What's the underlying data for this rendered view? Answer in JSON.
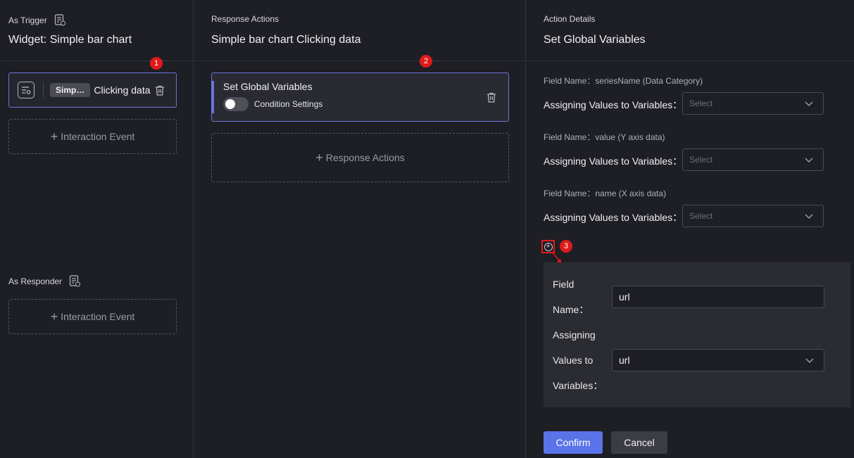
{
  "trigger": {
    "section_label": "As Trigger",
    "title": "Widget: Simple bar chart",
    "card": {
      "chip": "Simp…",
      "event": "Clicking data"
    },
    "add_event": "Interaction Event",
    "badge": "1"
  },
  "responder": {
    "section_label": "As Responder",
    "add_event": "Interaction Event"
  },
  "response": {
    "section_label": "Response Actions",
    "title": "Simple bar chart Clicking data",
    "badge": "2",
    "action": {
      "title": "Set Global Variables",
      "toggle_label": "Condition Settings",
      "toggle_on": false
    },
    "add_action": "Response Actions"
  },
  "details": {
    "section_label": "Action Details",
    "title": "Set Global Variables",
    "fields": [
      {
        "name": "Field Name：seriesName (Data Category)",
        "assign_label": "Assigning Values to Variables：",
        "placeholder": "Select"
      },
      {
        "name": "Field Name：value (Y axis data)",
        "assign_label": "Assigning Values to Variables：",
        "placeholder": "Select"
      },
      {
        "name": "Field Name：name (X axis data)",
        "assign_label": "Assigning Values to Variables：",
        "placeholder": "Select"
      }
    ],
    "badge": "3",
    "custom": {
      "field_label_1": "Field",
      "field_label_2": "Name：",
      "field_value": "url",
      "assign_label_1": "Assigning",
      "assign_label_2": "Values to",
      "assign_label_3": "Variables：",
      "assign_value": "url"
    },
    "confirm": "Confirm",
    "cancel": "Cancel"
  },
  "colors": {
    "accent": "#6b74d9",
    "confirm": "#5b73e8",
    "badge": "#e01a1a",
    "background": "#1e1e25"
  },
  "icons": [
    "document-help-icon",
    "list-settings-icon",
    "trash-icon",
    "plus-icon",
    "chevron-down-icon",
    "plus-circle-icon",
    "toggle-switch"
  ]
}
